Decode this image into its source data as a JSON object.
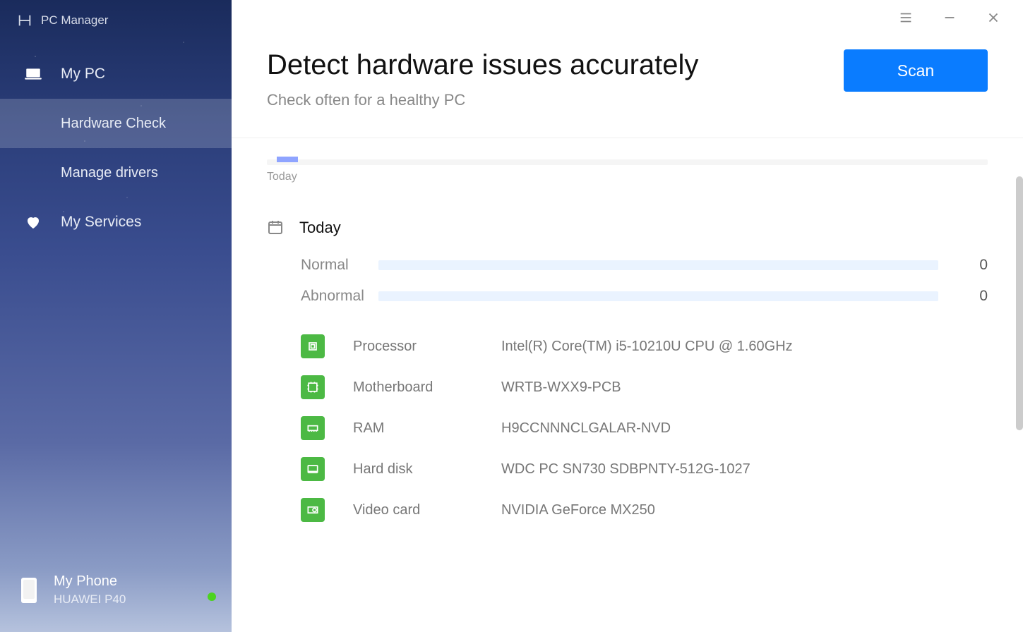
{
  "app_title": "PC Manager",
  "sidebar": {
    "items": [
      {
        "label": "My PC",
        "icon": "laptop-icon"
      },
      {
        "label": "Hardware Check"
      },
      {
        "label": "Manage drivers"
      },
      {
        "label": "My Services",
        "icon": "heart-icon"
      }
    ],
    "phone": {
      "title": "My Phone",
      "model": "HUAWEI P40"
    }
  },
  "header": {
    "title": "Detect hardware issues accurately",
    "subtitle": "Check often for a healthy PC",
    "scan_label": "Scan"
  },
  "timeline": {
    "label": "Today"
  },
  "day": {
    "title": "Today",
    "status": [
      {
        "label": "Normal",
        "count": "0"
      },
      {
        "label": "Abnormal",
        "count": "0"
      }
    ],
    "hardware": [
      {
        "icon": "cpu-icon",
        "name": "Processor",
        "value": "Intel(R) Core(TM) i5-10210U CPU @ 1.60GHz"
      },
      {
        "icon": "board-icon",
        "name": "Motherboard",
        "value": "WRTB-WXX9-PCB"
      },
      {
        "icon": "ram-icon",
        "name": "RAM",
        "value": "H9CCNNNCLGALAR-NVD"
      },
      {
        "icon": "disk-icon",
        "name": "Hard disk",
        "value": "WDC PC SN730 SDBPNTY-512G-1027"
      },
      {
        "icon": "gpu-icon",
        "name": "Video card",
        "value": "NVIDIA GeForce MX250"
      }
    ]
  }
}
